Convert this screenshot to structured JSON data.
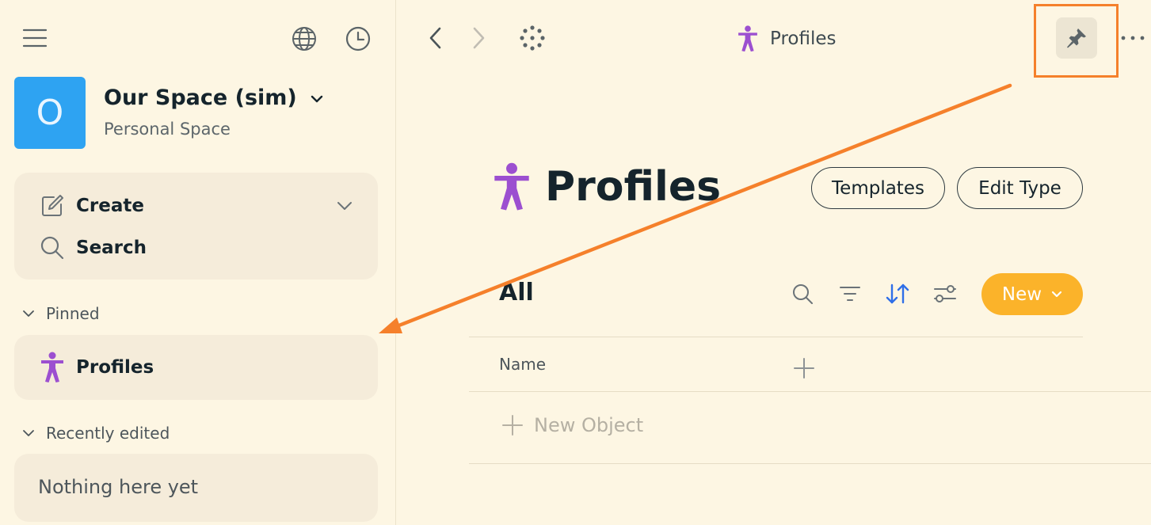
{
  "sidebar": {
    "menu_icon": "hamburger-icon",
    "globe_icon": "globe-icon",
    "history_icon": "clock-icon",
    "space": {
      "avatar_letter": "O",
      "avatar_color": "#2ea3f2",
      "name": "Our Space (sim)",
      "subtitle": "Personal Space"
    },
    "actions": {
      "create_label": "Create",
      "search_label": "Search"
    },
    "pinned": {
      "header": "Pinned",
      "items": [
        {
          "label": "Profiles",
          "icon": "person-icon",
          "icon_color": "#9c4fd0"
        }
      ]
    },
    "recent": {
      "header": "Recently edited",
      "empty_text": "Nothing here yet"
    }
  },
  "toolbar": {
    "title": "Profiles",
    "title_icon": "person-icon",
    "pin_icon": "pin-icon",
    "more_icon": "more-icon"
  },
  "page": {
    "title": "Profiles",
    "title_icon_color": "#9c4fd0",
    "templates_label": "Templates",
    "edit_type_label": "Edit Type",
    "view": {
      "tab_label": "All",
      "new_label": "New",
      "new_color": "#fbb32a",
      "sort_icon_color": "#2f6fe8",
      "columns": [
        "Name"
      ],
      "new_object_label": "New Object"
    }
  },
  "annotation": {
    "highlight_color": "#f5802b"
  }
}
